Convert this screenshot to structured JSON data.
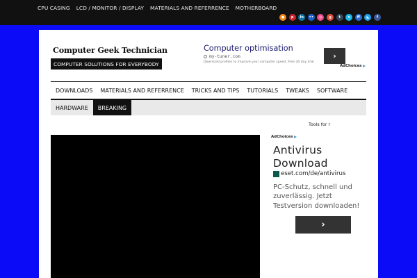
{
  "topnav": {
    "items": [
      "CPU CASING",
      "LCD / MONITOR / DISPLAY",
      "MATERIALS AND REFERRENCE",
      "MOTHERBOARD"
    ]
  },
  "social": [
    {
      "name": "rss-icon",
      "glyph": "●",
      "color": "#f2861b"
    },
    {
      "name": "pinterest-icon",
      "glyph": "p",
      "color": "#c8232c"
    },
    {
      "name": "linkedin-icon",
      "glyph": "in",
      "color": "#0e76a8"
    },
    {
      "name": "flickr-icon",
      "glyph": "••",
      "color": "#1c5fc9"
    },
    {
      "name": "dribbble-icon",
      "glyph": "◎",
      "color": "#ea4c89"
    },
    {
      "name": "googleplus-icon",
      "glyph": "g",
      "color": "#dd4b39"
    },
    {
      "name": "tumblr-icon",
      "glyph": "t",
      "color": "#35465c"
    },
    {
      "name": "vimeo-icon",
      "glyph": "v",
      "color": "#1ab7ea"
    },
    {
      "name": "friendfeed-icon",
      "glyph": "ff",
      "color": "#2d6bd1"
    },
    {
      "name": "twitter-icon",
      "glyph": "◣",
      "color": "#1da1f2"
    },
    {
      "name": "facebook-icon",
      "glyph": "f",
      "color": "#3b5998"
    }
  ],
  "site": {
    "title": "Computer Geek Technician",
    "tagline": "COMPUTER SOLUTIONS FOR EVERYBODY"
  },
  "ad_top": {
    "title": "Computer optimisation",
    "url": "my-tuner.com",
    "desc": "Download profiles to improve your computer speed. Free 30 day trial",
    "button_glyph": "›",
    "adchoices": "AdChoices"
  },
  "mainnav": {
    "items": [
      "DOWNLOADS",
      "MATERIALS AND REFERRENCE",
      "TRICKS AND TIPS",
      "TUTORIALS",
      "TWEAKS",
      "SOFTWARE"
    ]
  },
  "subnav": {
    "hardware": "HARDWARE",
    "breaking": "BREAKING"
  },
  "ticker": {
    "text": "Tools for r"
  },
  "ad_side": {
    "adchoices": "AdChoices",
    "title_line1": "Antivirus",
    "title_line2": "Download",
    "url": "eset.com/de/antivirus",
    "desc": "PC-Schutz, schnell und zuverlässig. Jetzt Testversion downloaden!",
    "button_glyph": "›"
  }
}
